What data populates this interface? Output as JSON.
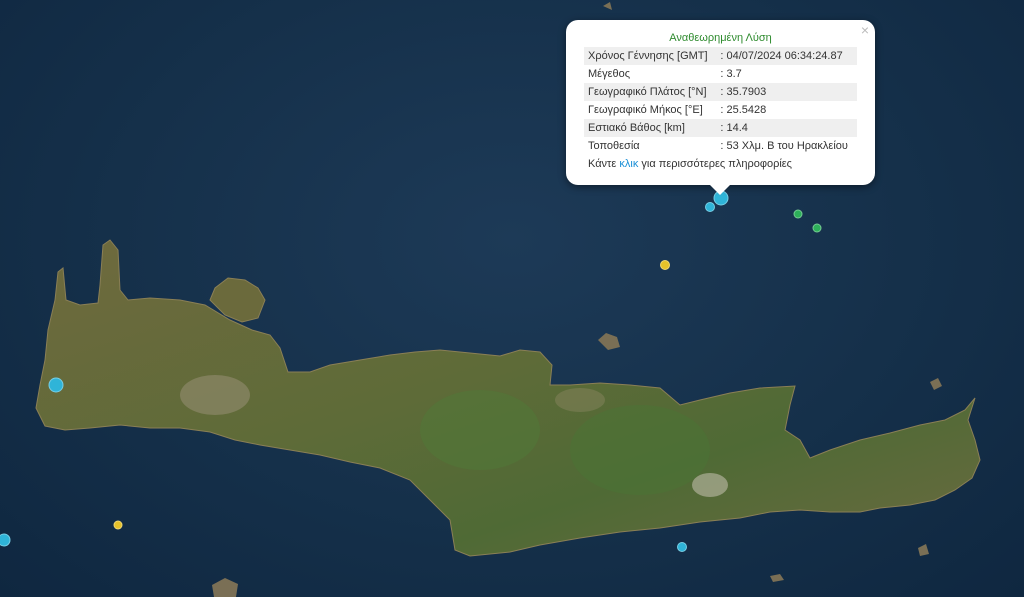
{
  "map": {
    "sea_color": "#15304a",
    "land_color": "#5a6a3a",
    "markers": [
      {
        "id": "selected",
        "color": "#2fb4d8"
      },
      {
        "id": "m2",
        "color": "#2fb4d8"
      },
      {
        "id": "m3",
        "color": "#2db05a"
      },
      {
        "id": "m4",
        "color": "#2db05a"
      },
      {
        "id": "m5",
        "color": "#e6c22a"
      },
      {
        "id": "m6",
        "color": "#2fb4d8"
      },
      {
        "id": "m7",
        "color": "#e6c22a"
      },
      {
        "id": "m8",
        "color": "#2fb4d8"
      },
      {
        "id": "m9",
        "color": "#2fb4d8"
      }
    ]
  },
  "popup": {
    "title": "Αναθεωρημένη Λύση",
    "title_color": "#2e8b2e",
    "close_symbol": "×",
    "rows": [
      {
        "label": "Χρόνος Γέννησης [GMT]",
        "value": "04/07/2024 06:34:24.87"
      },
      {
        "label": "Μέγεθος",
        "value": "3.7"
      },
      {
        "label": "Γεωγραφικό Πλάτος [°N]",
        "value": "35.7903"
      },
      {
        "label": "Γεωγραφικό Μήκος [°E]",
        "value": "25.5428"
      },
      {
        "label": "Εστιακό Βάθος [km]",
        "value": "14.4"
      },
      {
        "label": "Τοποθεσία",
        "value": "53 Χλμ. Β του Ηρακλείου"
      }
    ],
    "footer_prefix": "Κάντε ",
    "footer_link": "κλικ",
    "footer_suffix": " για περισσότερες πληροφορίες",
    "link_color": "#1a8fd6"
  }
}
